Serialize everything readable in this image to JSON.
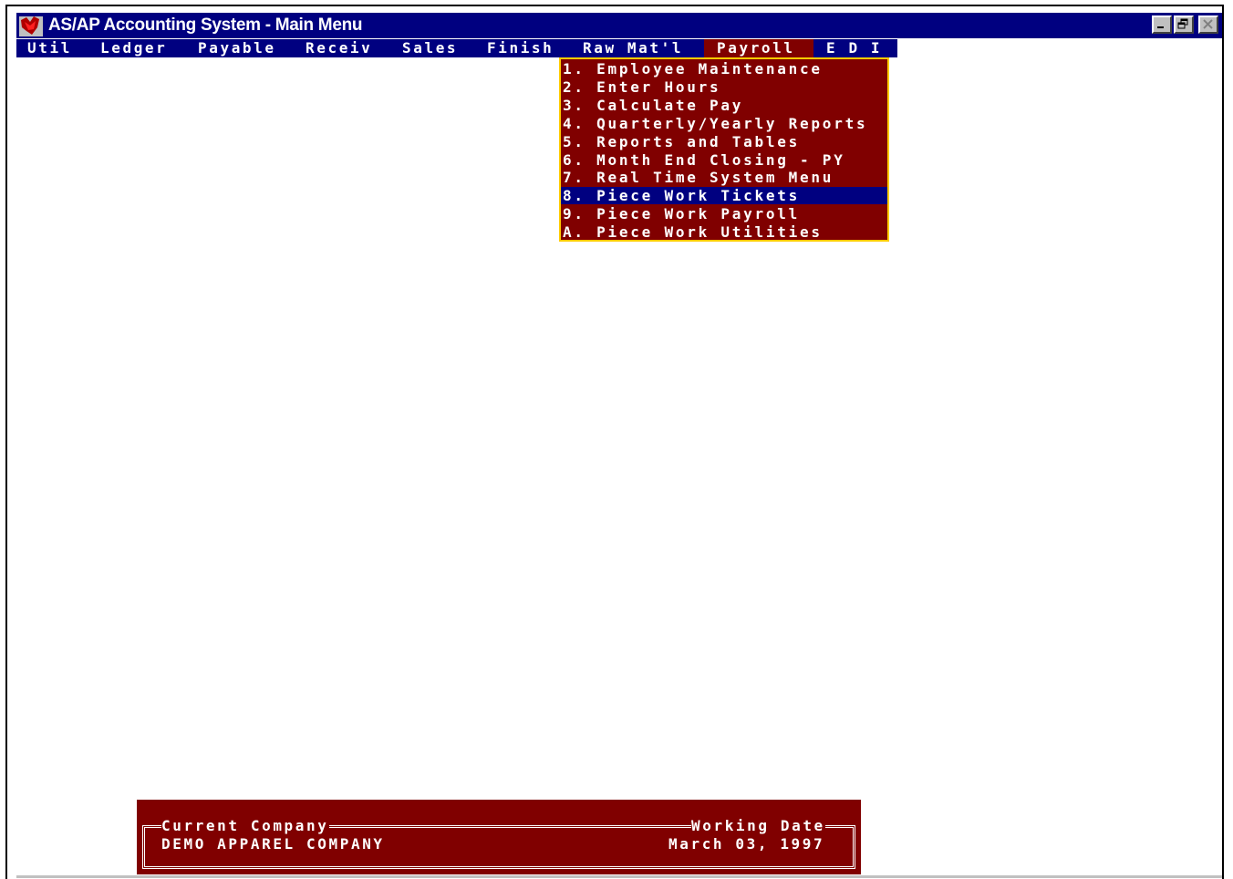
{
  "window": {
    "title": "AS/AP Accounting System - Main Menu",
    "icon": "app-logo-icon",
    "controls": [
      "minimize-icon",
      "restore-icon",
      "close-icon"
    ]
  },
  "menubar": {
    "items": [
      {
        "label": "Util"
      },
      {
        "label": "Ledger"
      },
      {
        "label": "Payable"
      },
      {
        "label": "Receiv"
      },
      {
        "label": "Sales"
      },
      {
        "label": "Finish"
      },
      {
        "label": "Raw Mat'l"
      },
      {
        "label": "Payroll",
        "active": true
      },
      {
        "label": "E D I"
      }
    ]
  },
  "dropdown": {
    "items": [
      {
        "label": "1. Employee Maintenance"
      },
      {
        "label": "2. Enter Hours"
      },
      {
        "label": "3. Calculate Pay"
      },
      {
        "label": "4. Quarterly/Yearly Reports"
      },
      {
        "label": "5. Reports and Tables"
      },
      {
        "label": "6. Month End Closing - PY"
      },
      {
        "label": "7. Real Time System Menu"
      },
      {
        "label": "8. Piece Work Tickets",
        "selected": true
      },
      {
        "label": "9. Piece Work Payroll"
      },
      {
        "label": "A. Piece Work Utilities"
      }
    ]
  },
  "status": {
    "company_label": "Current Company",
    "company_value": "DEMO APPAREL COMPANY",
    "date_label": "Working Date",
    "date_value": "March 03, 1997"
  },
  "colors": {
    "title_bar": "#000080",
    "menu_bg": "#000080",
    "active_menu": "#800000",
    "dropdown_bg": "#800000",
    "dropdown_border": "#ffcc00",
    "selected_item": "#000080",
    "status_bg": "#800000"
  }
}
